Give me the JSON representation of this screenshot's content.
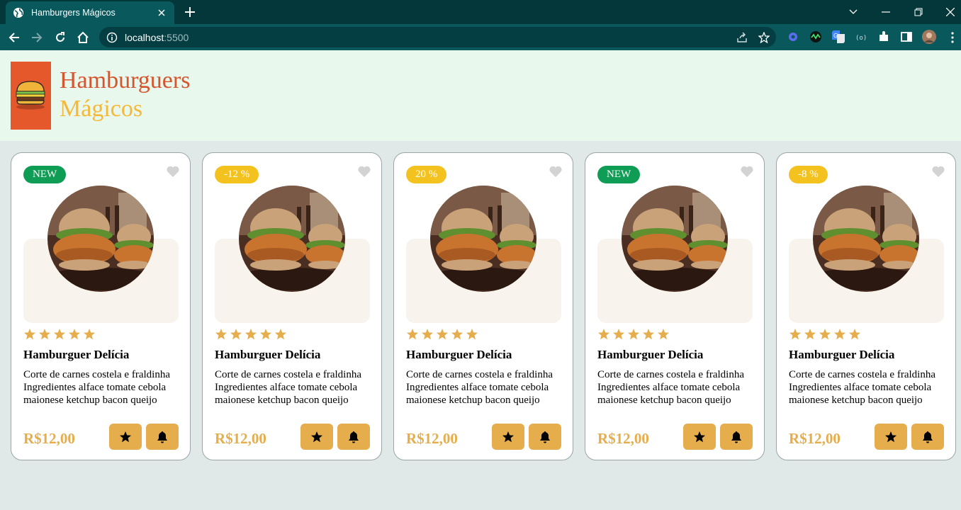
{
  "browser": {
    "tab_title": "Hamburgers Mágicos",
    "url_host": "localhost",
    "url_port": ":5500"
  },
  "header": {
    "brand_line1": "Hamburguers",
    "brand_line2": "Mágicos"
  },
  "colors": {
    "brand_orange": "#e4582c",
    "brand_yellow": "#f5b83a",
    "accent_gold": "#e6ad4c",
    "badge_new": "#0f9d55",
    "badge_sale": "#f4c21f"
  },
  "products": [
    {
      "badge": "NEW",
      "badge_type": "new",
      "rating": 5,
      "name": "Hamburguer Delícia",
      "desc1": "Corte de carnes costela e fraldinha",
      "desc2": "Ingredientes alface tomate cebola maionese ketchup bacon queijo",
      "price": "R$12,00"
    },
    {
      "badge": "-12 %",
      "badge_type": "sale",
      "rating": 5,
      "name": "Hamburguer Delícia",
      "desc1": "Corte de carnes costela e fraldinha",
      "desc2": "Ingredientes alface tomate cebola maionese ketchup bacon queijo",
      "price": "R$12,00"
    },
    {
      "badge": "20 %",
      "badge_type": "sale",
      "rating": 5,
      "name": "Hamburguer Delícia",
      "desc1": "Corte de carnes costela e fraldinha",
      "desc2": "Ingredientes alface tomate cebola maionese ketchup bacon queijo",
      "price": "R$12,00"
    },
    {
      "badge": "NEW",
      "badge_type": "new",
      "rating": 5,
      "name": "Hamburguer Delícia",
      "desc1": "Corte de carnes costela e fraldinha",
      "desc2": "Ingredientes alface tomate cebola maionese ketchup bacon queijo",
      "price": "R$12,00"
    },
    {
      "badge": "-8 %",
      "badge_type": "sale",
      "rating": 5,
      "name": "Hamburguer Delícia",
      "desc1": "Corte de carnes costela e fraldinha",
      "desc2": "Ingredientes alface tomate cebola maionese ketchup bacon queijo",
      "price": "R$12,00"
    }
  ]
}
